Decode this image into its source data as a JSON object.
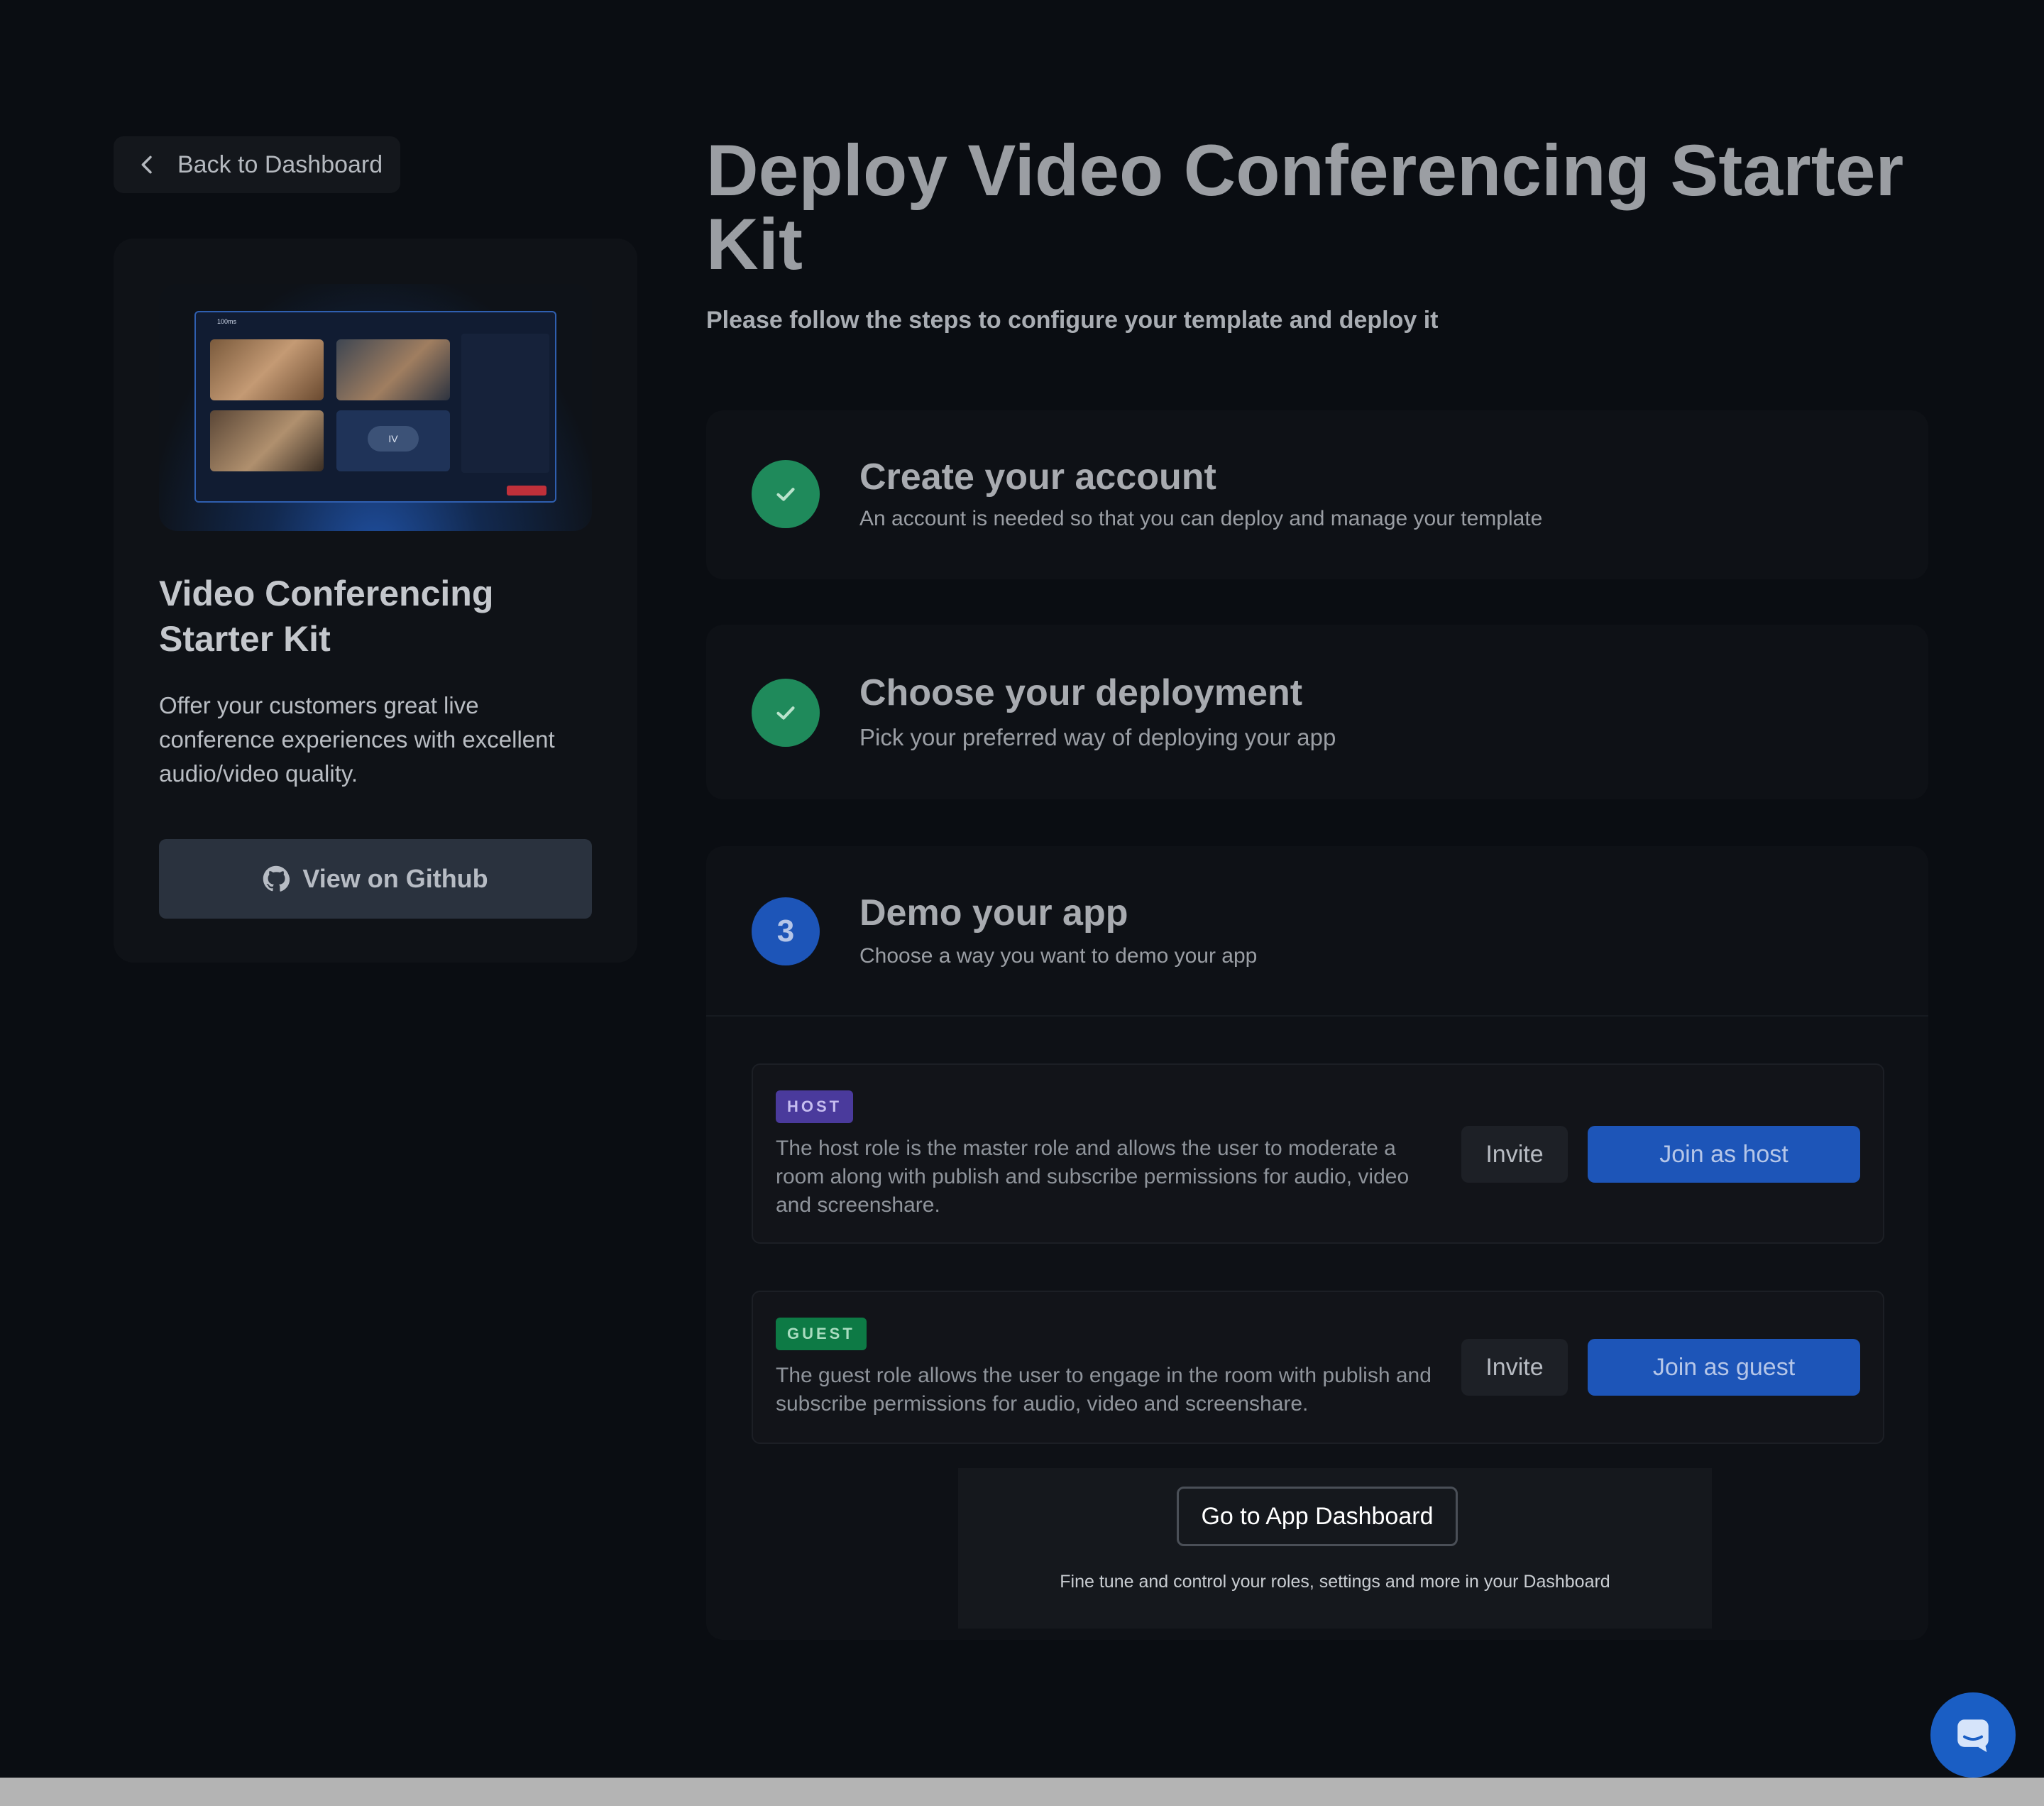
{
  "nav": {
    "back_label": "Back to Dashboard"
  },
  "kit": {
    "title": "Video Conferencing Starter Kit",
    "description": "Offer your customers great live conference experiences with excellent audio/video quality.",
    "github_label": "View on Github",
    "preview": {
      "brand": "100ms",
      "tile_initials": "IV"
    }
  },
  "header": {
    "title": "Deploy Video Conferencing Starter Kit",
    "subtitle": "Please follow the steps to configure your template and deploy it"
  },
  "steps": [
    {
      "title": "Create your account",
      "description": "An account is needed so that you can deploy and manage your template",
      "status": "done"
    },
    {
      "title": "Choose your deployment",
      "description": "Pick your preferred way of deploying your app",
      "status": "done"
    },
    {
      "number": "3",
      "title": "Demo your app",
      "description": "Choose a way you want to demo your app",
      "status": "active"
    }
  ],
  "roles": [
    {
      "badge": "HOST",
      "description": "The host role is the master role and allows the user to moderate a room along with publish and subscribe permissions for audio, video and screenshare.",
      "invite_label": "Invite",
      "join_label": "Join as host"
    },
    {
      "badge": "GUEST",
      "description": "The guest role allows the user to engage in the room with publish and subscribe permissions for audio, video and screenshare.",
      "invite_label": "Invite",
      "join_label": "Join as guest"
    }
  ],
  "dashboard": {
    "button_label": "Go to App Dashboard",
    "note": "Fine tune and control your roles, settings and more in your Dashboard"
  },
  "colors": {
    "success": "#1f8a5b",
    "accent": "#1d55b8",
    "host_badge": "#4a3a9c",
    "guest_badge": "#0d7a45"
  }
}
